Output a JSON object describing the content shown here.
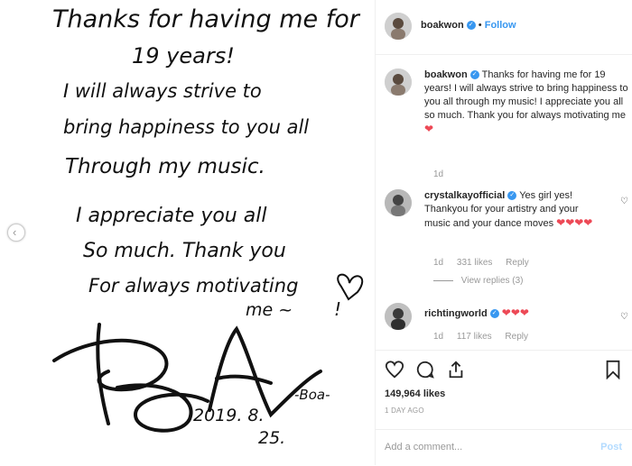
{
  "post": {
    "author": "boakwon",
    "follow_dot": "•",
    "follow_label": "Follow",
    "caption_text": "Thanks for having me for 19 years! I will always strive to bring happiness to you all through my music! I appreciate you all so much. Thank you for always motivating me",
    "caption_emoji": "❤",
    "caption_age": "1d",
    "likes": "149,964 likes",
    "time_ago": "1 DAY AGO"
  },
  "letter": {
    "lines": [
      "Thanks for having me for",
      "19 years!",
      "I will always strive to",
      "bring happiness to you all",
      "Through my music.",
      "I appreciate you all",
      "So much. Thank you",
      "For always motivating",
      "me ~",
      "-Boa-",
      "2019. 8.",
      "25."
    ]
  },
  "comments": [
    {
      "user": "crystalkayofficial",
      "text": "Yes girl yes! Thankyou for your artistry and your music and your dance moves",
      "emoji": "❤❤❤❤",
      "age": "1d",
      "likes": "331 likes",
      "reply": "Reply",
      "view_replies": "View replies (3)"
    },
    {
      "user": "richtingworld",
      "text": "",
      "emoji": "❤❤❤",
      "age": "1d",
      "likes": "117 likes",
      "reply": "Reply"
    }
  ],
  "comment_box": {
    "placeholder": "Add a comment...",
    "post_label": "Post"
  },
  "colors": {
    "accent": "#3897f0",
    "heart": "#ed4956",
    "muted": "#999999"
  },
  "icons": [
    "heart-icon",
    "comment-icon",
    "share-icon",
    "bookmark-icon",
    "verified-icon",
    "chevron-left-icon"
  ]
}
